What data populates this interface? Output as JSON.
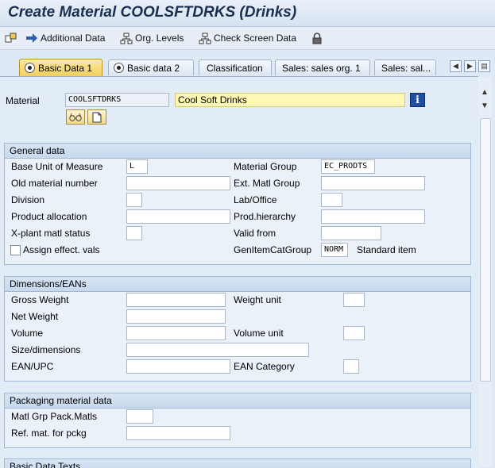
{
  "title": "Create Material COOLSFTDRKS (Drinks)",
  "toolbar": {
    "additional_data": "Additional Data",
    "org_levels": "Org. Levels",
    "check_screen_data": "Check Screen Data"
  },
  "tabs": [
    "Basic Data 1",
    "Basic data 2",
    "Classification",
    "Sales: sales org. 1",
    "Sales: sal..."
  ],
  "header": {
    "material_label": "Material",
    "material_value": "COOLSFTDRKS",
    "material_desc": "Cool Soft Drinks"
  },
  "general": {
    "title": "General data",
    "base_uom_label": "Base Unit of Measure",
    "base_uom_value": "L",
    "old_matnr_label": "Old material number",
    "division_label": "Division",
    "prod_alloc_label": "Product allocation",
    "xplant_label": "X-plant matl status",
    "assign_label": "Assign effect. vals",
    "matl_group_label": "Material Group",
    "matl_group_value": "EC_PRODTS",
    "ext_matl_label": "Ext. Matl Group",
    "lab_office_label": "Lab/Office",
    "prod_hier_label": "Prod.hierarchy",
    "valid_from_label": "Valid from",
    "gen_item_label": "GenItemCatGroup",
    "gen_item_value": "NORM",
    "gen_item_desc": "Standard item"
  },
  "dimensions": {
    "title": "Dimensions/EANs",
    "gross_weight_label": "Gross Weight",
    "net_weight_label": "Net Weight",
    "volume_label": "Volume",
    "size_label": "Size/dimensions",
    "ean_label": "EAN/UPC",
    "weight_unit_label": "Weight unit",
    "volume_unit_label": "Volume unit",
    "ean_cat_label": "EAN Category"
  },
  "packaging": {
    "title": "Packaging material data",
    "matl_grp_label": "Matl Grp Pack.Matls",
    "ref_mat_label": "Ref. mat. for pckg"
  },
  "texts": {
    "title": "Basic Data Texts"
  },
  "colors": {
    "active_tab": "#f4cf5a",
    "desc_field": "#fff7b5",
    "title_text": "#1b2f4e"
  }
}
